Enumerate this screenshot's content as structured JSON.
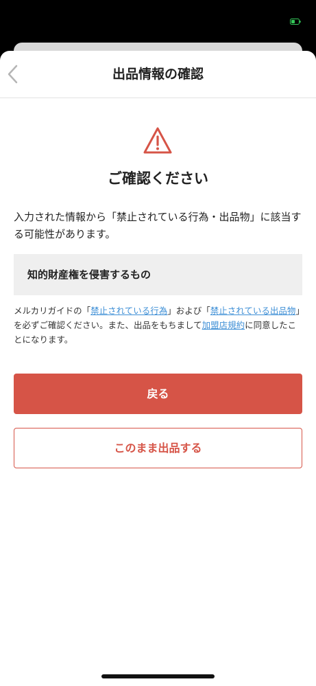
{
  "status_bar": {
    "battery_icon": "battery-charging-icon",
    "battery_color": "#34c759"
  },
  "nav": {
    "back_icon": "chevron-left-icon",
    "title": "出品情報の確認"
  },
  "alert": {
    "icon": "warning-triangle-icon",
    "icon_color": "#d65447",
    "heading": "ご確認ください",
    "description": "入力された情報から「禁止されている行為・出品物」に該当する可能性があります。"
  },
  "category": {
    "label": "知的財産権を侵害するもの"
  },
  "guide": {
    "prefix": "メルカリガイドの「",
    "link1": "禁止されている行為",
    "middle1": "」および「",
    "link2": "禁止されている出品物",
    "middle2": "」を必ずご確認ください。また、出品をもちまして",
    "link3": "加盟店規約",
    "suffix": "に同意したことになります。",
    "link_color": "#3e8fd6"
  },
  "actions": {
    "back_label": "戻る",
    "proceed_label": "このまま出品する",
    "accent_color": "#d65447"
  }
}
